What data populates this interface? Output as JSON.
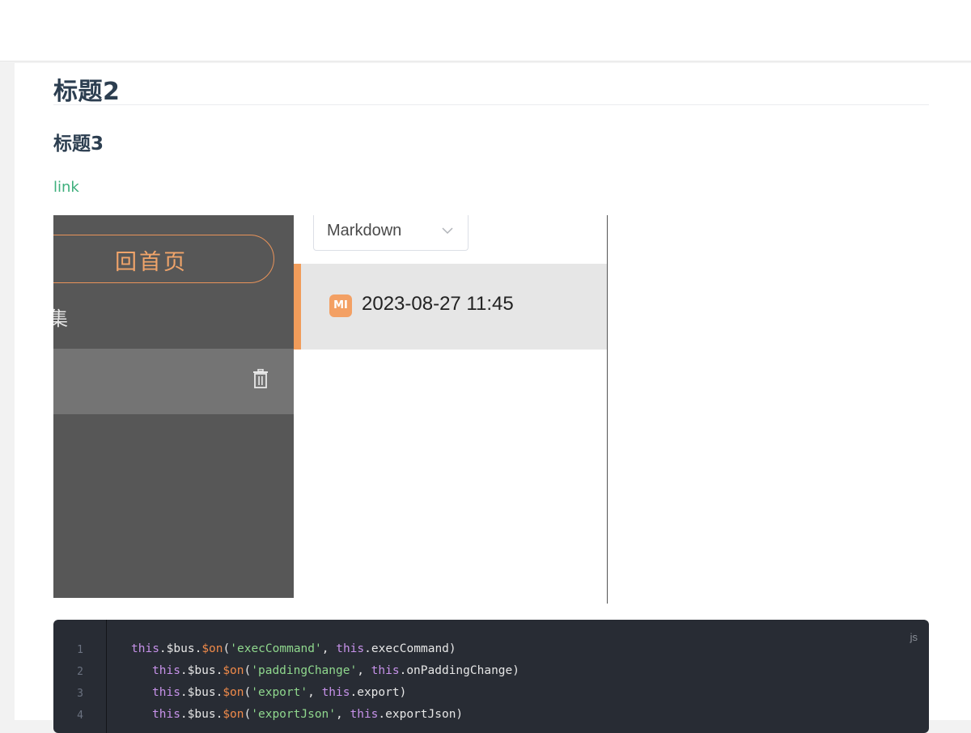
{
  "doc": {
    "heading2": "标题2",
    "heading3": "标题3",
    "link_text": "link"
  },
  "embedded_screenshot": {
    "home_button_label": "回首页",
    "partial_text": "集",
    "select_value": "Markdown",
    "note_badge": "MI",
    "note_date": "2023-08-27 11:45",
    "icons": [
      "trash-icon",
      "chevron-down-icon"
    ]
  },
  "code_block": {
    "language": "js",
    "line_numbers": [
      "1",
      "2",
      "3",
      "4"
    ],
    "lines": [
      [
        {
          "t": "this",
          "c": "kw"
        },
        {
          "t": ".$bus.",
          "c": "pl"
        },
        {
          "t": "$on",
          "c": "fn"
        },
        {
          "t": "(",
          "c": "pl"
        },
        {
          "t": "'execCommand'",
          "c": "str"
        },
        {
          "t": ", ",
          "c": "pl"
        },
        {
          "t": "this",
          "c": "kw"
        },
        {
          "t": ".execCommand)",
          "c": "pl"
        }
      ],
      [
        {
          "t": "this",
          "c": "kw"
        },
        {
          "t": ".$bus.",
          "c": "pl"
        },
        {
          "t": "$on",
          "c": "fn"
        },
        {
          "t": "(",
          "c": "pl"
        },
        {
          "t": "'paddingChange'",
          "c": "str"
        },
        {
          "t": ", ",
          "c": "pl"
        },
        {
          "t": "this",
          "c": "kw"
        },
        {
          "t": ".onPaddingChange)",
          "c": "pl"
        }
      ],
      [
        {
          "t": "this",
          "c": "kw"
        },
        {
          "t": ".$bus.",
          "c": "pl"
        },
        {
          "t": "$on",
          "c": "fn"
        },
        {
          "t": "(",
          "c": "pl"
        },
        {
          "t": "'export'",
          "c": "str"
        },
        {
          "t": ", ",
          "c": "pl"
        },
        {
          "t": "this",
          "c": "kw"
        },
        {
          "t": ".export)",
          "c": "pl"
        }
      ],
      [
        {
          "t": "this",
          "c": "kw"
        },
        {
          "t": ".$bus.",
          "c": "pl"
        },
        {
          "t": "$on",
          "c": "fn"
        },
        {
          "t": "(",
          "c": "pl"
        },
        {
          "t": "'exportJson'",
          "c": "str"
        },
        {
          "t": ", ",
          "c": "pl"
        },
        {
          "t": "this",
          "c": "kw"
        },
        {
          "t": ".exportJson)",
          "c": "pl"
        }
      ]
    ]
  },
  "colors": {
    "link": "#3eaf7c",
    "heading": "#2c3e50",
    "accent_orange": "#f19c5a",
    "code_bg": "#282c34"
  }
}
